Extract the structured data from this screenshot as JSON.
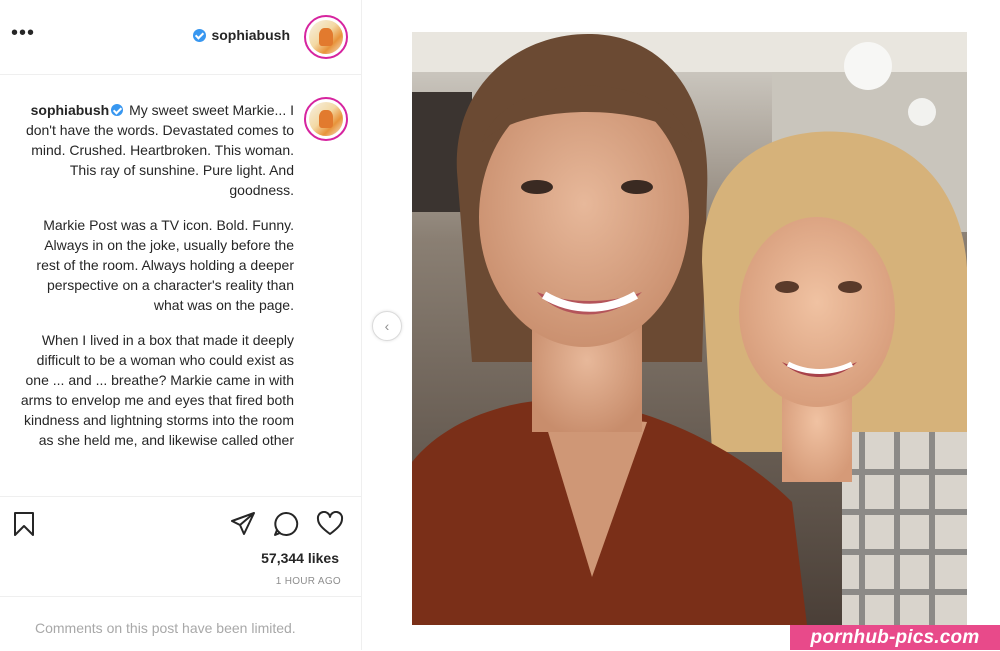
{
  "header": {
    "username": "sophiabush",
    "more_glyph": "•••"
  },
  "caption": {
    "username": "sophiabush",
    "paragraphs": [
      "My sweet sweet Markie... I don't have the words. Devastated comes to mind. Crushed. Heartbroken. This woman. This ray of sunshine. Pure light. And goodness.",
      "Markie Post was a TV icon. Bold. Funny. Always in on the joke, usually before the rest of the room. Always holding a deeper perspective on a character's reality than what was on the page.",
      "When I lived in a box that made it deeply difficult to be a woman who could exist as one ... and ... breathe? Markie came in with arms to envelop me and eyes that fired both kindness and lightning storms into the room as she held me, and likewise called other"
    ]
  },
  "actions": {
    "likes": "57,344 likes",
    "timestamp": "1 HOUR AGO",
    "icons": [
      "bookmark-icon",
      "share-icon",
      "comment-icon",
      "heart-icon"
    ]
  },
  "comments_notice": "Comments on this post have been limited.",
  "carousel": {
    "arrow_glyph": "‹"
  },
  "watermark": "pornhub-pics.com",
  "colors": {
    "verified": "#3897f0",
    "avatar_ring": "#d6249f",
    "muted_text": "#8e8e8e",
    "watermark_bg": "#e84a8a"
  }
}
